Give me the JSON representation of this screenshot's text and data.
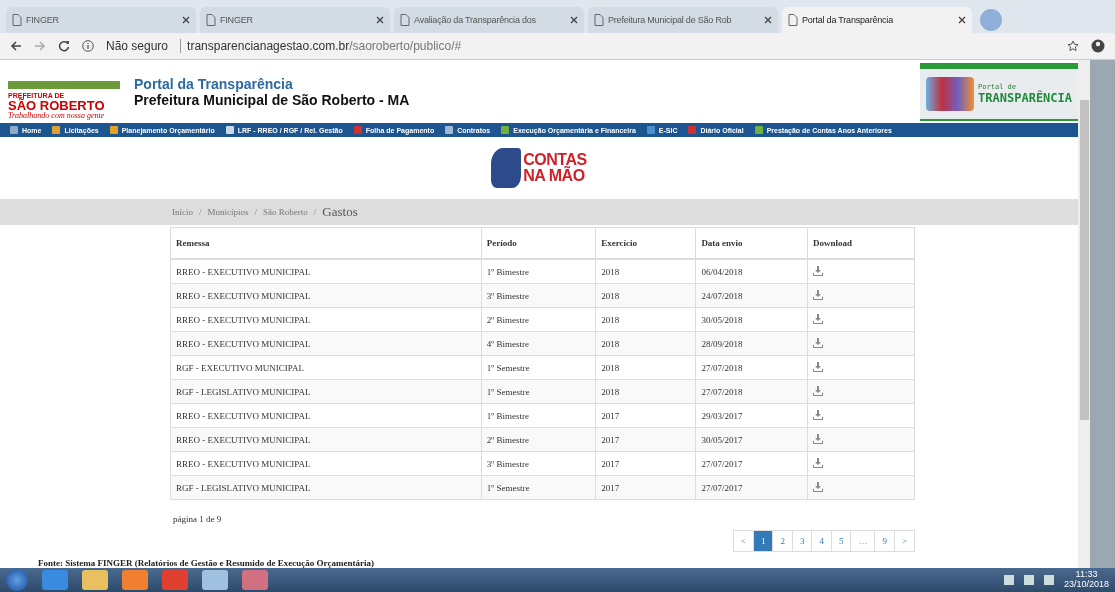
{
  "browser_tabs": [
    {
      "title": "FINGER",
      "selected": false
    },
    {
      "title": "FINGER",
      "selected": false
    },
    {
      "title": "Avaliação da Transparência dos",
      "selected": false
    },
    {
      "title": "Prefeitura Municipal de São Rob",
      "selected": false
    },
    {
      "title": "Portal da Transparência",
      "selected": true
    }
  ],
  "address_bar": {
    "security": "Não seguro",
    "host": "transparencianagestao.com.br",
    "path": "/saoroberto/publico/#"
  },
  "header": {
    "logo": {
      "top": "PREFEITURA DE",
      "name": "SÃO ROBERTO",
      "motto": "Trabalhando com nossa gente"
    },
    "title": "Portal da Transparência",
    "subtitle": "Prefeitura Municipal de São Roberto - MA",
    "badge": {
      "small": "Portal de",
      "big": "TRANSPARÊNCIA"
    }
  },
  "nav": [
    {
      "label": "Home",
      "color": "#8fa9c9"
    },
    {
      "label": "Licitações",
      "color": "#e0a030"
    },
    {
      "label": "Planejamento Orçamentário",
      "color": "#e8a020"
    },
    {
      "label": "LRF - RREO / RGF / Rel. Gestão",
      "color": "#c8d8e8"
    },
    {
      "label": "Folha de Pagamento",
      "color": "#d03030"
    },
    {
      "label": "Contratos",
      "color": "#a0b8d8"
    },
    {
      "label": "Execução Orçamentária e Financeira",
      "color": "#70b040"
    },
    {
      "label": "E-SIC",
      "color": "#4a90d0"
    },
    {
      "label": "Diário Oficial",
      "color": "#d03030"
    },
    {
      "label": "Prestação de Contas Anos Anteriores",
      "color": "#70b040"
    }
  ],
  "brand": {
    "line1": "CONTAS",
    "line2": "NA MÃO"
  },
  "breadcrumb_separator": "/",
  "breadcrumb": [
    "Início",
    "Municípios",
    "São Roberto",
    "Gastos"
  ],
  "table": {
    "columns": [
      "Remessa",
      "Período",
      "Exercício",
      "Data envio",
      "Download"
    ],
    "rows": [
      [
        "RREO - EXECUTIVO MUNICIPAL",
        "1º Bimestre",
        "2018",
        "06/04/2018"
      ],
      [
        "RREO - EXECUTIVO MUNICIPAL",
        "3º Bimestre",
        "2018",
        "24/07/2018"
      ],
      [
        "RREO - EXECUTIVO MUNICIPAL",
        "2º Bimestre",
        "2018",
        "30/05/2018"
      ],
      [
        "RREO - EXECUTIVO MUNICIPAL",
        "4º Bimestre",
        "2018",
        "28/09/2018"
      ],
      [
        "RGF - EXECUTIVO MUNICIPAL",
        "1º Semestre",
        "2018",
        "27/07/2018"
      ],
      [
        "RGF - LEGISLATIVO MUNICIPAL",
        "1º Semestre",
        "2018",
        "27/07/2018"
      ],
      [
        "RREO - EXECUTIVO MUNICIPAL",
        "1º Bimestre",
        "2017",
        "29/03/2017"
      ],
      [
        "RREO - EXECUTIVO MUNICIPAL",
        "2º Bimestre",
        "2017",
        "30/05/2017"
      ],
      [
        "RREO - EXECUTIVO MUNICIPAL",
        "3º Bimestre",
        "2017",
        "27/07/2017"
      ],
      [
        "RGF - LEGISLATIVO MUNICIPAL",
        "1º Semestre",
        "2017",
        "27/07/2017"
      ]
    ]
  },
  "page_info": "página 1 de 9",
  "pagination": [
    {
      "label": "<",
      "selected": false
    },
    {
      "label": "1",
      "selected": true
    },
    {
      "label": "2",
      "selected": false
    },
    {
      "label": "3",
      "selected": false
    },
    {
      "label": "4",
      "selected": false
    },
    {
      "label": "5",
      "selected": false
    },
    {
      "label": "…",
      "selected": false
    },
    {
      "label": "9",
      "selected": false
    },
    {
      "label": ">",
      "selected": false
    }
  ],
  "footer": "Fonte: Sistema FINGER (Relatórios de Gestão e Resumido de Execução Orçamentária)",
  "taskbar": {
    "time": "11:33",
    "date": "23/10/2018"
  }
}
